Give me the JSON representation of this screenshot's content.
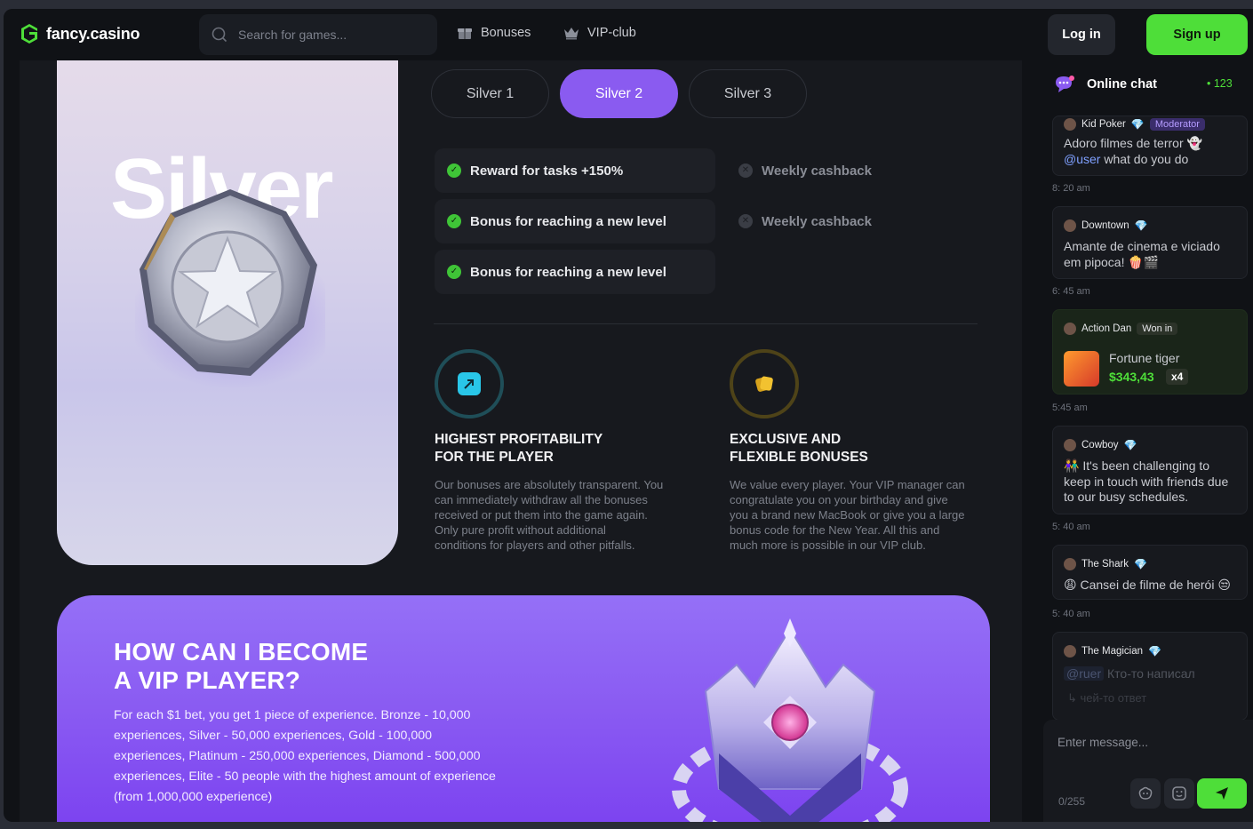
{
  "header": {
    "logo_text": "fancy.casino",
    "search_placeholder": "Search for games...",
    "nav": [
      {
        "label": "Bonuses",
        "icon": "gift-icon"
      },
      {
        "label": "VIP-club",
        "icon": "crown-icon"
      }
    ],
    "login_label": "Log in",
    "signup_label": "Sign up"
  },
  "level_card": {
    "title": "Silver"
  },
  "tabs": [
    {
      "label": "Silver 1",
      "active": false
    },
    {
      "label": "Silver 2",
      "active": true
    },
    {
      "label": "Silver 3",
      "active": false
    }
  ],
  "features": {
    "included": [
      "Reward for tasks +150%",
      "Bonus for reaching a new level",
      "Bonus for reaching a new level"
    ],
    "excluded": [
      "Weekly cashback",
      "Weekly cashback"
    ]
  },
  "highlights": [
    {
      "title": "Highest profitability\nfor the player",
      "text": "Our bonuses are absolutely transparent. You\ncan immediately withdraw all the bonuses\nreceived or put them into the game again.\nOnly pure profit without additional\nconditions for players and other pitfalls."
    },
    {
      "title": "Exclusive and\nflexible bonuses",
      "text": "We value every player. Your VIP manager can\ncongratulate you on your birthday and give\nyou a brand new MacBook or give you a large\nbonus code for the New Year. All this and\nmuch more is possible in our VIP club."
    }
  ],
  "vip": {
    "title": "HOW CAN I BECOME\nA VIP PLAYER?",
    "text": "For each $1 bet, you get 1 piece of experience. Bronze - 10,000 experiences, Silver - 50,000 experiences, Gold - 100,000 experiences, Platinum - 250,000 experiences, Diamond - 500,000 experiences, Elite - 50 people with the highest amount of experience (from 1,000,000 experience)"
  },
  "chat": {
    "title": "Online chat",
    "online": "• 123",
    "messages": [
      {
        "user": "Kid Poker",
        "badge": "Moderator",
        "text_mention": "",
        "text": "Adoro filmes de terror 👻",
        "text2_mention": "@user",
        "text2": " what do you do",
        "time": "8: 20 am"
      },
      {
        "user": "Downtown",
        "text": "Amante de cinema e viciado em pipoca! 🍿🎬",
        "time": "6: 45 am"
      },
      {
        "user": "Action Dan",
        "badge": "Won in",
        "game": "Fortune tiger",
        "amount": "$343,43",
        "multiplier": "x4",
        "time": "5:45 am"
      },
      {
        "user": "Cowboy",
        "text": "👫 It's been challenging to keep in touch with friends due to our busy schedules.",
        "time": "5: 40 am"
      },
      {
        "user": "The Shark",
        "text": "😩 Cansei de filme de herói 😒",
        "time": "5: 40 am"
      },
      {
        "user": "The Magician",
        "mention": "@ruer",
        "text": " Кто-то написал",
        "reply": "чей-то ответ"
      }
    ],
    "input_placeholder": "Enter message...",
    "char_count": "0/255"
  },
  "colors": {
    "accent_green": "#4ede39",
    "accent_purple": "#8a5bf0",
    "background": "#101216"
  }
}
